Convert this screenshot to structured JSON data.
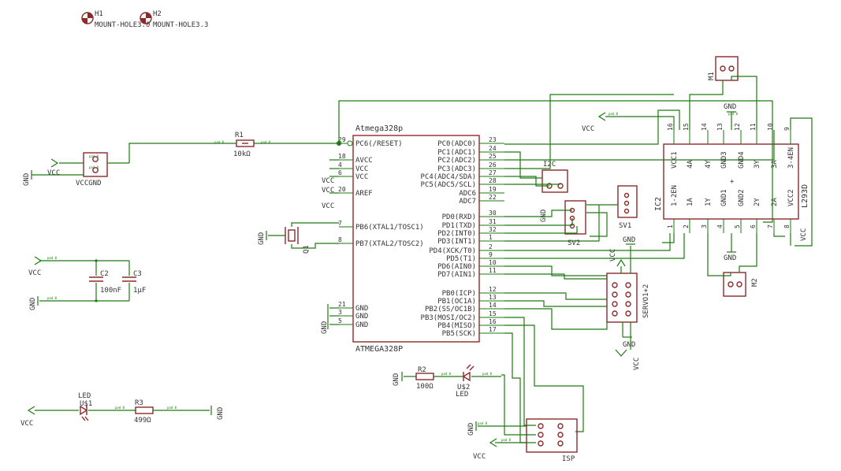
{
  "mount_holes": [
    {
      "name": "H1",
      "value": "MOUNT-HOLE3.0"
    },
    {
      "name": "H2",
      "value": "MOUNT-HOLE3.3"
    }
  ],
  "mcu": {
    "name": "Atmega328p",
    "value": "ATMEGA328P",
    "left_pins": [
      {
        "label": "PC6(/RESET)",
        "num": "29"
      },
      {
        "label": "AVCC",
        "num": "18"
      },
      {
        "label": "VCC",
        "num": "4"
      },
      {
        "label": "VCC",
        "num": "6"
      },
      {
        "label": "AREF",
        "num": "20"
      },
      {
        "label": "PB6(XTAL1/TOSC1)",
        "num": "7"
      },
      {
        "label": "PB7(XTAL2/TOSC2)",
        "num": "8"
      },
      {
        "label": "GND",
        "num": "21"
      },
      {
        "label": "GND",
        "num": "3"
      },
      {
        "label": "GND",
        "num": "5"
      }
    ],
    "right_pins": [
      {
        "label": "PC0(ADC0)",
        "num": "23"
      },
      {
        "label": "PC1(ADC1)",
        "num": "24"
      },
      {
        "label": "PC2(ADC2)",
        "num": "25"
      },
      {
        "label": "PC3(ADC3)",
        "num": "26"
      },
      {
        "label": "PC4(ADC4/SDA)",
        "num": "27"
      },
      {
        "label": "PC5(ADC5/SCL)",
        "num": "28"
      },
      {
        "label": "ADC6",
        "num": "19"
      },
      {
        "label": "ADC7",
        "num": "22"
      },
      {
        "label": "PD0(RXD)",
        "num": "30"
      },
      {
        "label": "PD1(TXD)",
        "num": "31"
      },
      {
        "label": "PD2(INT0)",
        "num": "32"
      },
      {
        "label": "PD3(INT1)",
        "num": "1"
      },
      {
        "label": "PD4(XCK/T0)",
        "num": "2"
      },
      {
        "label": "PD5(T1)",
        "num": "9"
      },
      {
        "label": "PD6(AIN0)",
        "num": "10"
      },
      {
        "label": "PD7(AIN1)",
        "num": "11"
      },
      {
        "label": "PB0(ICP)",
        "num": "12"
      },
      {
        "label": "PB1(OC1A)",
        "num": "13"
      },
      {
        "label": "PB2(SS/OC1B)",
        "num": "14"
      },
      {
        "label": "PB3(MOSI/OC2)",
        "num": "15"
      },
      {
        "label": "PB4(MISO)",
        "num": "16"
      },
      {
        "label": "PB5(SCK)",
        "num": "17"
      }
    ]
  },
  "driver": {
    "name": "IC2",
    "value": "L293D",
    "top_labels": [
      "VCC1",
      "4A",
      "4Y",
      "GND3",
      "GND4",
      "3Y",
      "3A",
      "3-4EN"
    ],
    "top_nums": [
      "16",
      "15",
      "14",
      "13",
      "12",
      "11",
      "10",
      "9"
    ],
    "bottom_labels": [
      "1-2EN",
      "1A",
      "1Y",
      "GND1",
      "GND2",
      "2Y",
      "2A",
      "VCC2"
    ],
    "bottom_nums": [
      "1",
      "2",
      "3",
      "4",
      "5",
      "6",
      "7",
      "8"
    ]
  },
  "parts": {
    "r1_name": "R1",
    "r1_value": "10kΩ",
    "r2_name": "R2",
    "r2_value": "100Ω",
    "r3_name": "R3",
    "r3_value": "499Ω",
    "c2_name": "C2",
    "c2_value": "100nF",
    "c3_name": "C3",
    "c3_value": "1µF",
    "q1_name": "Q1",
    "led1_label": "LED",
    "led1_name": "U$1",
    "led2_name": "U$2",
    "led2_label": "LED",
    "vccgnd": "VCCGND",
    "i2c": "I2C",
    "sv1": "SV1",
    "sv2": "SV2",
    "servo": "SERVO1+2",
    "isp": "ISP",
    "m1": "M1",
    "m2": "M2"
  },
  "net_labels": {
    "vcc": "VCC",
    "gnd": "GND",
    "pad": "pad 0"
  },
  "colors": {
    "wire": "#1e7a12",
    "part": "#8c2a2a",
    "text": "#333333"
  }
}
